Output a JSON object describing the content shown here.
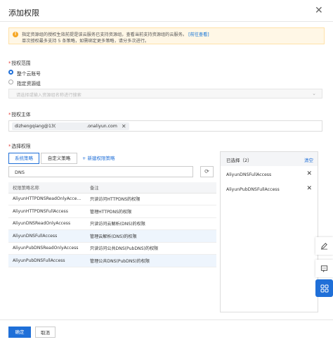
{
  "header": {
    "title": "添加权限",
    "close_icon": "close-icon"
  },
  "notice": {
    "line1": "指定资源组的授权生效前提是该云服务已支持资源组，查看当前支持资源组的云服务。",
    "link": "[前往查看]",
    "line2": "单次授权最多支持 5 条策略，如需绑定更多策略，请分多次进行。",
    "icon": "warning-icon"
  },
  "scope": {
    "label": "授权范围",
    "options": [
      {
        "label": "整个云账号",
        "selected": true
      },
      {
        "label": "指定资源组",
        "selected": false
      }
    ],
    "select_placeholder": "请选择或输入资源组名称进行搜索"
  },
  "principal": {
    "label": "授权主体",
    "tag_user": "dizhengqiang@13(",
    "tag_domain": ".onaliyun.com"
  },
  "policies": {
    "label": "选择权限",
    "tabs": [
      {
        "label": "系统策略",
        "active": true
      },
      {
        "label": "自定义策略",
        "active": false
      }
    ],
    "new_policy": "+ 新建权限策略",
    "search_value": "DNS",
    "columns": [
      "权限策略名称",
      "备注"
    ],
    "rows": [
      {
        "name": "AliyunHTTPDNSReadOnlyAcce...",
        "note": "只读访问HTTPDNS的权限",
        "highlight": false
      },
      {
        "name": "AliyunHTTPDNSFullAccess",
        "note": "管理HTTPDNS的权限",
        "highlight": false
      },
      {
        "name": "AliyunDNSReadOnlyAccess",
        "note": "只读访问云解析(DNS)的权限",
        "highlight": false
      },
      {
        "name": "AliyunDNSFullAccess",
        "note": "管理云解析(DNS)的权限",
        "highlight": true
      },
      {
        "name": "AliyunPubDNSReadOnlyAccess",
        "note": "只读访问公共DNS(PubDNS)的权限",
        "highlight": false
      },
      {
        "name": "AliyunPubDNSFullAccess",
        "note": "管理公共DNS(PubDNS)的权限",
        "highlight": true
      }
    ]
  },
  "selected": {
    "title": "已选择（2）",
    "clear": "清空",
    "items": [
      "AliyunDNSFullAccess",
      "AliyunPubDNSFullAccess"
    ]
  },
  "footer": {
    "ok": "确定",
    "cancel": "取消"
  },
  "colors": {
    "primary": "#1f6fd8",
    "notice_bg": "#fff7e6",
    "required": "#e53935"
  }
}
